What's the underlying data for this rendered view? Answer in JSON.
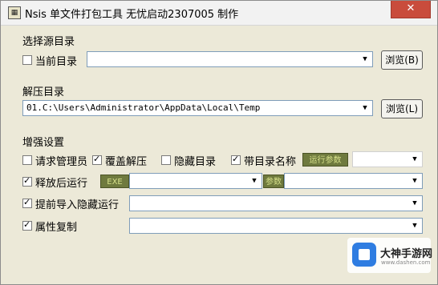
{
  "window": {
    "title": "Nsis 单文件打包工具 无忧启动2307005 制作",
    "close_label": "✕"
  },
  "source": {
    "group_label": "选择源目录",
    "current_dir_label": "当前目录",
    "current_dir_checked": false,
    "dir_value": "",
    "browse_label": "浏览(B)"
  },
  "extract": {
    "group_label": "解压目录",
    "dir_value": "01.C:\\Users\\Administrator\\AppData\\Local\\Temp",
    "browse_label": "浏览(L)"
  },
  "enhance": {
    "group_label": "增强设置",
    "request_admin_label": "请求管理员",
    "request_admin_checked": false,
    "overwrite_label": "覆盖解压",
    "overwrite_checked": true,
    "hide_dir_label": "隐藏目录",
    "hide_dir_checked": false,
    "with_dirname_label": "带目录名称",
    "with_dirname_checked": true,
    "run_params_tag": "运行参数",
    "run_params_value": "",
    "run_after_label": "释放后运行",
    "run_after_checked": true,
    "exe_tag": "EXE",
    "exe_value": "",
    "param_tag": "参数",
    "param_value": "",
    "preimport_label": "提前导入隐藏运行",
    "preimport_checked": true,
    "preimport_value": "",
    "attr_copy_label": "属性复制",
    "attr_copy_checked": true,
    "attr_copy_value": ""
  },
  "watermark": {
    "title": "大神手游网",
    "subtitle": "www.dashen.com"
  }
}
